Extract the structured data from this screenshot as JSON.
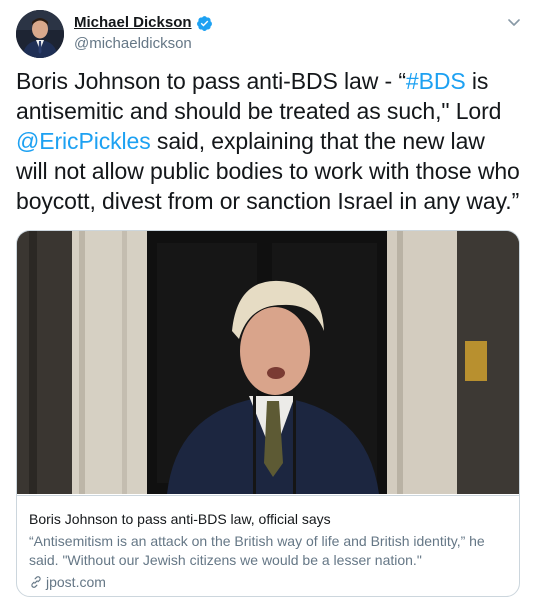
{
  "author": {
    "name": "Michael Dickson",
    "handle": "@michaeldickson",
    "verified": true
  },
  "tweet": {
    "text_part1": "Boris Johnson to pass anti-BDS law - “",
    "hashtag": "#BDS",
    "text_part2": " is antisemitic and should be treated as such,\" Lord ",
    "mention": "@EricPickles",
    "text_part3": " said, explaining that the new law will not allow public bodies to work with those who boycott, divest from or sanction Israel in any way.”"
  },
  "card": {
    "title": "Boris Johnson to pass anti-BDS law, official says",
    "description": "“Antisemitism is an attack on the British way of life and British identity,” he said. \"Without our Jewish citizens we would be a lesser nation.\"",
    "domain": "jpost.com"
  },
  "colors": {
    "link": "#1da1f2",
    "muted": "#657786",
    "border": "#ccd6dd"
  },
  "icons": [
    "avatar",
    "verified-badge-icon",
    "chevron-down-icon",
    "link-icon"
  ]
}
